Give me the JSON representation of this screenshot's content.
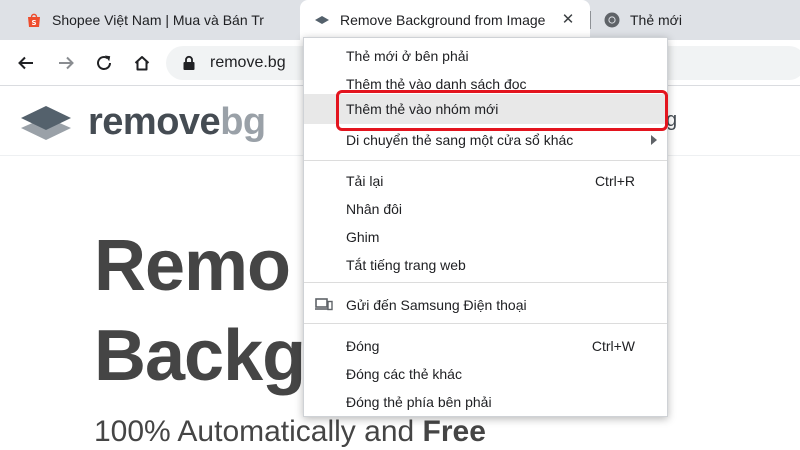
{
  "tabs": [
    {
      "title": "Shopee Việt Nam | Mua và Bán Tr",
      "icon": "shopee-bag-icon",
      "active": false
    },
    {
      "title": "Remove Background from Image",
      "icon": "removebg-logo-icon",
      "active": true
    },
    {
      "title": "Thẻ mới",
      "icon": "chrome-logo-icon",
      "active": false
    }
  ],
  "toolbar": {
    "url": "remove.bg"
  },
  "page": {
    "logo_part1": "remove",
    "logo_part2": "bg",
    "nav_fragment": "g",
    "hero_line1": "Remo",
    "hero_line2": "Backg",
    "hero_sub_prefix": "100% Automatically and ",
    "hero_sub_bold": "Free"
  },
  "context_menu": {
    "groups": [
      [
        {
          "label": "Thẻ mới ở bên phải"
        },
        {
          "label": "Thêm thẻ vào danh sách đọc"
        },
        {
          "label": "Thêm thẻ vào nhóm mới",
          "highlighted": true
        },
        {
          "label": "Di chuyển thẻ sang một cửa sổ khác",
          "submenu": true
        }
      ],
      [
        {
          "label": "Tải lại",
          "shortcut": "Ctrl+R"
        },
        {
          "label": "Nhân đôi"
        },
        {
          "label": "Ghim"
        },
        {
          "label": "Tắt tiếng trang web"
        }
      ],
      [
        {
          "label": "Gửi đến Samsung Điện thoại",
          "icon": "send-to-device-icon"
        }
      ],
      [
        {
          "label": "Đóng",
          "shortcut": "Ctrl+W"
        },
        {
          "label": "Đóng các thẻ khác"
        },
        {
          "label": "Đóng thẻ phía bên phải"
        }
      ]
    ]
  },
  "colors": {
    "tabstrip": "#dee1e6",
    "highlight_outline": "#e3141e",
    "logo_dark": "#454c53",
    "logo_light": "#9aa1a8"
  }
}
